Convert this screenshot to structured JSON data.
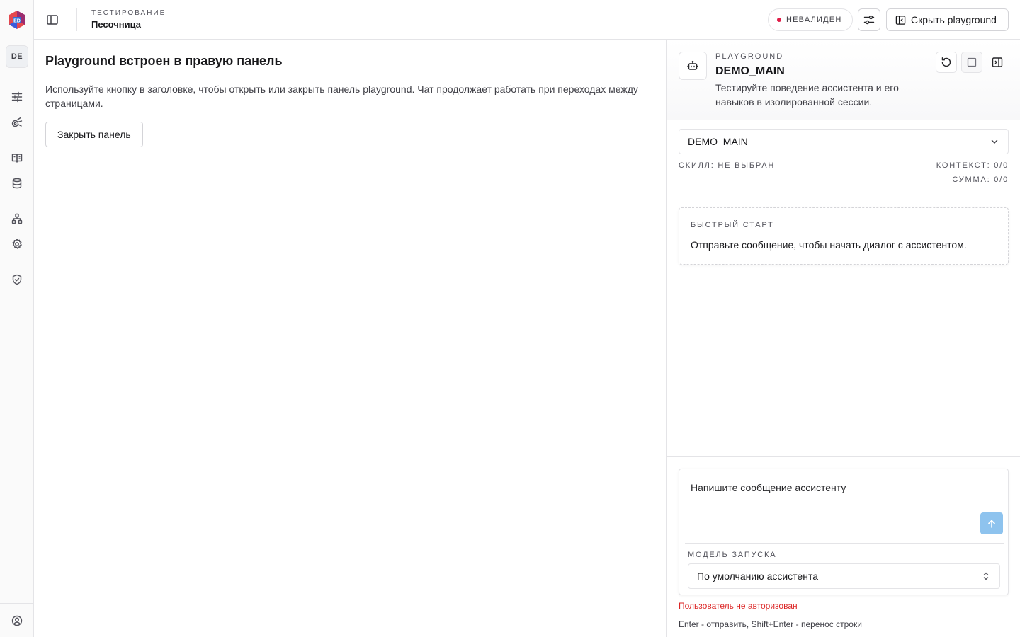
{
  "rail": {
    "workspace_badge": "DE",
    "items": [
      {
        "icon": "sliders-icon"
      },
      {
        "icon": "skills-icon"
      },
      {
        "icon": "book-icon"
      },
      {
        "icon": "database-icon"
      },
      {
        "icon": "network-icon"
      },
      {
        "icon": "gear-icon"
      },
      {
        "icon": "shield-check-icon"
      }
    ],
    "user_icon": "user-circle-icon"
  },
  "header": {
    "breadcrumb_section": "ТЕСТИРОВАНИЕ",
    "breadcrumb_title": "Песочница",
    "status": "НЕВАЛИДЕН",
    "status_color": "#e11d48",
    "hide_playground_label": "Скрыть playground"
  },
  "main": {
    "title": "Playground встроен в правую панель",
    "description": "Используйте кнопку в заголовке, чтобы открыть или закрыть панель playground. Чат продолжает работать при переходах между страницами.",
    "close_panel_label": "Закрыть панель"
  },
  "panel": {
    "label": "PLAYGROUND",
    "name": "DEMO_MAIN",
    "description": "Тестируйте поведение ассистента и его навыков в изолированной сессии.",
    "assistant_selected": "DEMO_MAIN",
    "skill": "СКИЛЛ: НЕ ВЫБРАН",
    "context": "КОНТЕКСТ: 0/0",
    "sum": "СУММА: 0/0",
    "quick_start_label": "БЫСТРЫЙ СТАРТ",
    "quick_start_text": "Отправьте сообщение, чтобы начать диалог с ассистентом.",
    "input_placeholder": "Напишите сообщение ассистенту",
    "model_label": "МОДЕЛЬ ЗАПУСКА",
    "model_selected": "По умолчанию ассистента",
    "auth_error": "Пользователь не авторизован",
    "hint": "Enter - отправить, Shift+Enter - перенос строки",
    "send_color": "#8ec3ee"
  }
}
